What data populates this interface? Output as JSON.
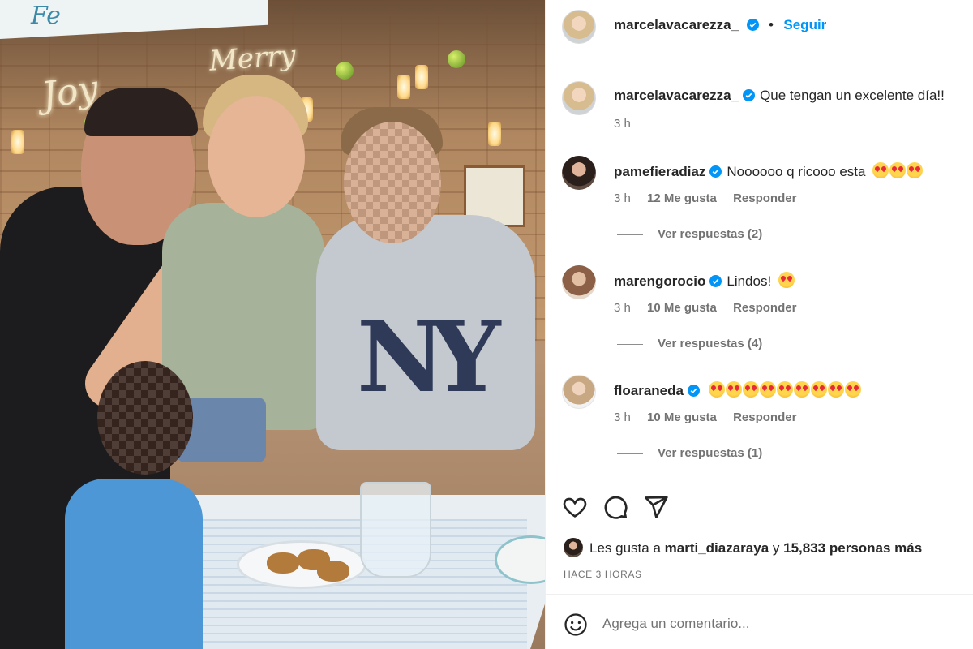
{
  "photo": {
    "banner_text": "Fe",
    "sign_joy": "Joy",
    "sign_merry": "Merry",
    "shirt_logo": "NY"
  },
  "post": {
    "author": "marcelavacarezza_",
    "follow_label": "Seguir",
    "separator": "•",
    "caption": "Que tengan un excelente día!!",
    "caption_time": "3 h"
  },
  "comments": [
    {
      "username": "pamefieradiaz",
      "text": "Noooooo q ricooo esta",
      "emoji_count": 3,
      "time": "3 h",
      "likes": "12 Me gusta",
      "reply_label": "Responder",
      "view_replies": "Ver respuestas (2)"
    },
    {
      "username": "marengorocio",
      "text": "Lindos!",
      "emoji_count": 1,
      "time": "3 h",
      "likes": "10 Me gusta",
      "reply_label": "Responder",
      "view_replies": "Ver respuestas (4)"
    },
    {
      "username": "floaraneda",
      "text": "",
      "emoji_count": 9,
      "time": "3 h",
      "likes": "10 Me gusta",
      "reply_label": "Responder",
      "view_replies": "Ver respuestas (1)"
    }
  ],
  "likes": {
    "prefix": "Les gusta a",
    "user": "marti_diazaraya",
    "connector": "y",
    "others": "15,833 personas más"
  },
  "time_ago": "HACE 3 HORAS",
  "add_comment": {
    "placeholder": "Agrega un comentario..."
  },
  "icons": {
    "like": "heart-icon",
    "comment": "comment-bubble-icon",
    "share": "paper-plane-icon",
    "emoji": "smiley-icon",
    "verified": "verified-badge-icon"
  },
  "colors": {
    "accent": "#0095f6",
    "text": "#262626",
    "secondary": "#737373",
    "divider": "#efefef"
  }
}
